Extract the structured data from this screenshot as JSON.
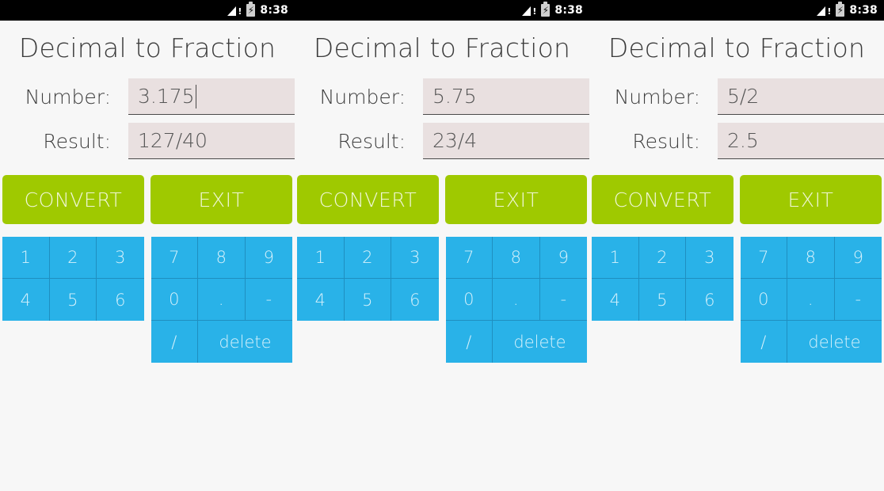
{
  "app": {
    "title": "Decimal to Fraction",
    "accent_green": "#9fc900",
    "accent_blue": "#29b2e8",
    "field_bg": "#e9e0e0",
    "page_bg": "#f7f7f7"
  },
  "status_bar": {
    "time": "8:38",
    "signal_icon": "signal-warning-icon",
    "battery_icon": "battery-charging-icon",
    "battery_glyph": "⚡",
    "signal_glyph": "!"
  },
  "labels": {
    "number": "Number:",
    "result": "Result:"
  },
  "buttons": {
    "convert": "CONVERT",
    "exit": "EXIT"
  },
  "keypad_left": {
    "keys": [
      "1",
      "2",
      "3",
      "4",
      "5",
      "6"
    ]
  },
  "keypad_right": {
    "keys": [
      "7",
      "8",
      "9",
      "0",
      ".",
      "-"
    ],
    "slash": "/",
    "delete": "delete"
  },
  "panels": [
    {
      "number_value": "3.175",
      "result_value": "127/40",
      "focused": true
    },
    {
      "number_value": "5.75",
      "result_value": "23/4",
      "focused": false
    },
    {
      "number_value": "5/2",
      "result_value": "2.5",
      "focused": false
    }
  ]
}
